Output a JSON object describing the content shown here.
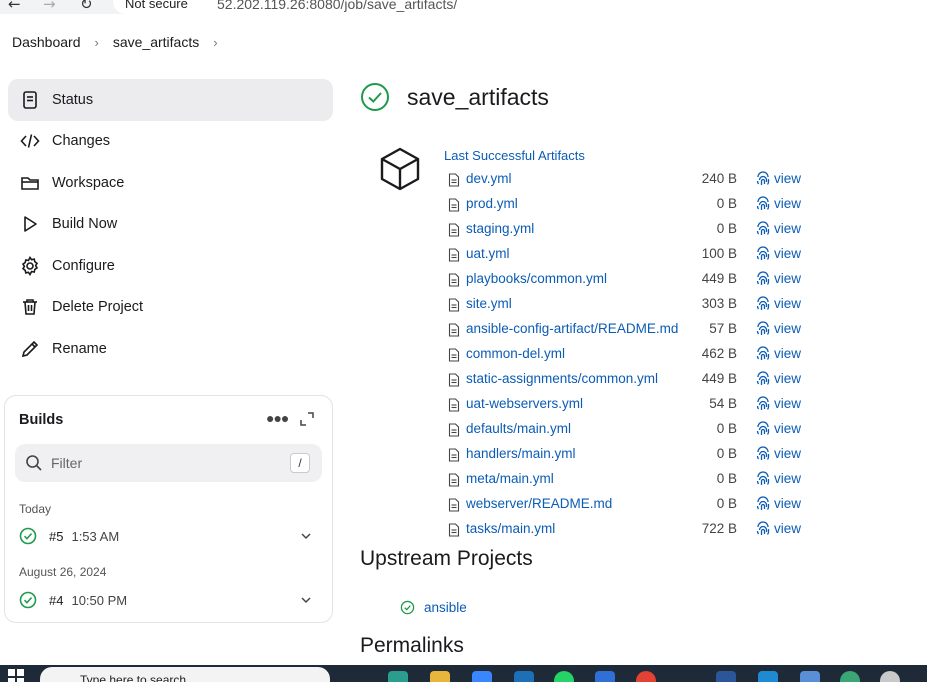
{
  "browser": {
    "secure_label": "Not secure",
    "url": "52.202.119.26:8080/job/save_artifacts/"
  },
  "breadcrumb": {
    "items": [
      "Dashboard",
      "save_artifacts"
    ]
  },
  "sidebar": {
    "items": [
      {
        "label": "Status",
        "icon": "status-icon"
      },
      {
        "label": "Changes",
        "icon": "code-icon"
      },
      {
        "label": "Workspace",
        "icon": "folder-icon"
      },
      {
        "label": "Build Now",
        "icon": "play-icon"
      },
      {
        "label": "Configure",
        "icon": "gear-icon"
      },
      {
        "label": "Delete Project",
        "icon": "trash-icon"
      },
      {
        "label": "Rename",
        "icon": "pencil-icon"
      }
    ]
  },
  "builds": {
    "title": "Builds",
    "filter_placeholder": "Filter",
    "filter_shortcut": "/",
    "groups": [
      {
        "label": "Today",
        "builds": [
          {
            "number": "#5",
            "time": "1:53 AM"
          }
        ]
      },
      {
        "label": "August 26, 2024",
        "builds": [
          {
            "number": "#4",
            "time": "10:50 PM"
          }
        ]
      }
    ]
  },
  "main": {
    "title": "save_artifacts",
    "artifacts_heading": "Last Successful Artifacts",
    "view_label": "view",
    "artifacts": [
      {
        "name": "dev.yml",
        "size": "240 B"
      },
      {
        "name": "prod.yml",
        "size": "0 B"
      },
      {
        "name": "staging.yml",
        "size": "0 B"
      },
      {
        "name": "uat.yml",
        "size": "100 B"
      },
      {
        "name": "playbooks/common.yml",
        "size": "449 B"
      },
      {
        "name": "site.yml",
        "size": "303 B"
      },
      {
        "name": "ansible-config-artifact/README.md",
        "size": "57 B"
      },
      {
        "name": "common-del.yml",
        "size": "462 B"
      },
      {
        "name": "static-assignments/common.yml",
        "size": "449 B"
      },
      {
        "name": "uat-webservers.yml",
        "size": "54 B"
      },
      {
        "name": "defaults/main.yml",
        "size": "0 B"
      },
      {
        "name": "handlers/main.yml",
        "size": "0 B"
      },
      {
        "name": "meta/main.yml",
        "size": "0 B"
      },
      {
        "name": "webserver/README.md",
        "size": "0 B"
      },
      {
        "name": "tasks/main.yml",
        "size": "722 B"
      }
    ],
    "upstream_heading": "Upstream Projects",
    "upstream": [
      {
        "name": "ansible"
      }
    ],
    "permalinks_heading": "Permalinks"
  },
  "taskbar": {
    "search_text": "Type here to search"
  },
  "colors": {
    "link": "#0b5cb5",
    "success": "#1e9a4a",
    "active_bg": "#ececee"
  }
}
